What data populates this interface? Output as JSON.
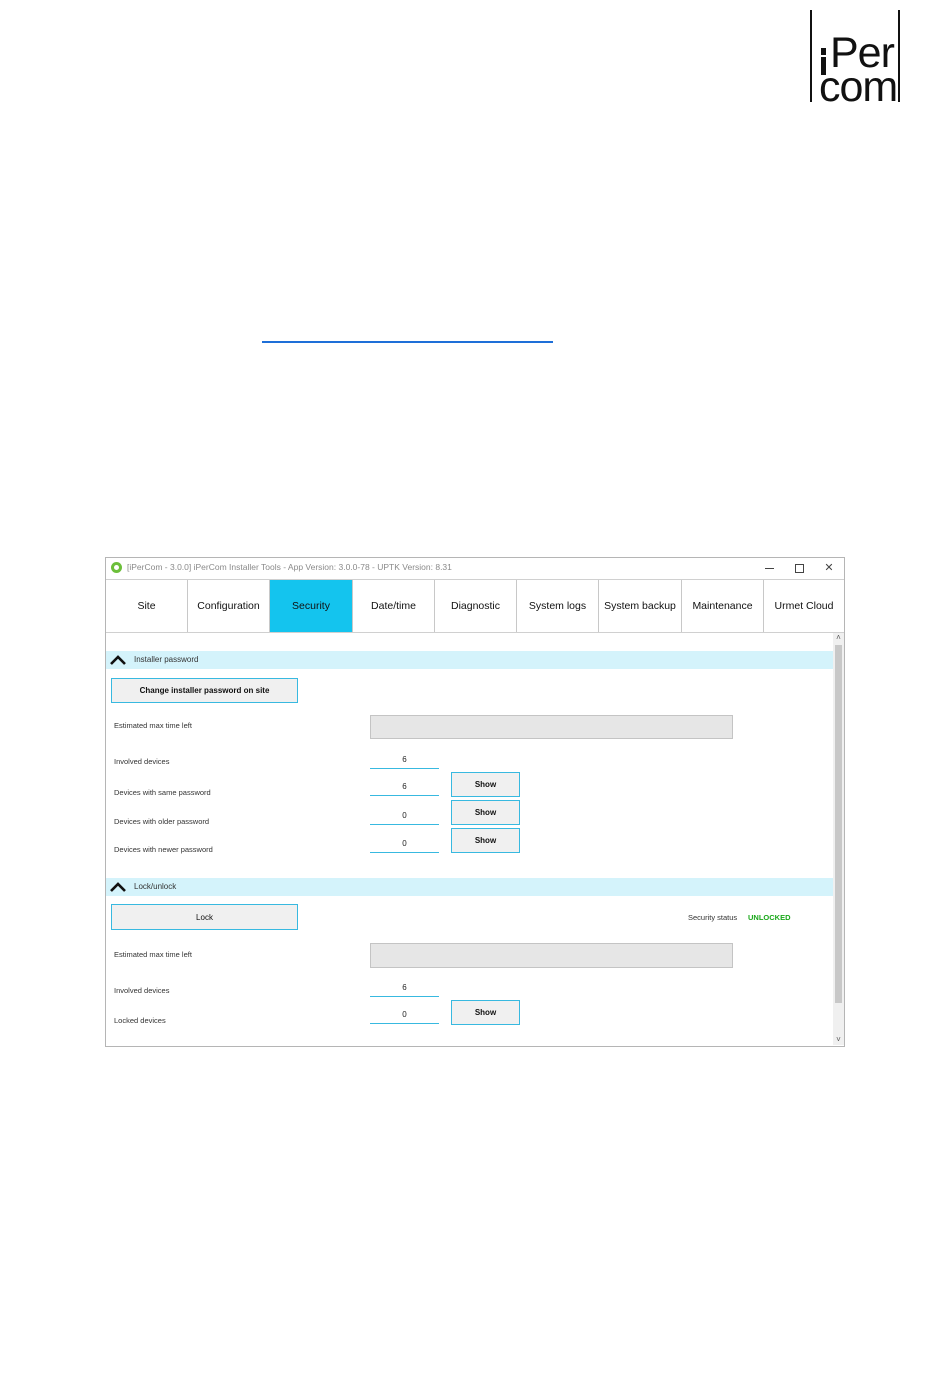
{
  "logo": {
    "line1": "Per",
    "line2": "com"
  },
  "window": {
    "title": "[iPerCom - 3.0.0] iPerCom Installer Tools - App Version: 3.0.0-78 - UPTK Version: 8.31",
    "controls": {
      "minimize_icon": "minimize-icon",
      "maximize_icon": "maximize-icon",
      "close_icon": "close-icon",
      "close": "✕"
    }
  },
  "tabs": [
    {
      "label": "Site",
      "active": false
    },
    {
      "label": "Configuration",
      "active": false
    },
    {
      "label": "Security",
      "active": true
    },
    {
      "label": "Date/time",
      "active": false
    },
    {
      "label": "Diagnostic",
      "active": false
    },
    {
      "label": "System logs",
      "active": false
    },
    {
      "label": "System backup",
      "active": false
    },
    {
      "label": "Maintenance",
      "active": false
    },
    {
      "label": "Urmet Cloud",
      "active": false
    }
  ],
  "installer_password": {
    "header": "Installer password",
    "change_button": "Change installer password on site",
    "estimated_label": "Estimated max time left",
    "involved_label": "Involved devices",
    "involved_value": "6",
    "same_label": "Devices with same password",
    "same_value": "6",
    "older_label": "Devices with older password",
    "older_value": "0",
    "newer_label": "Devices with newer password",
    "newer_value": "0",
    "show_label": "Show"
  },
  "lock_unlock": {
    "header": "Lock/unlock",
    "lock_button": "Lock",
    "security_status_label": "Security status",
    "security_status_value": "UNLOCKED",
    "estimated_label": "Estimated max time left",
    "involved_label": "Involved devices",
    "involved_value": "6",
    "locked_label": "Locked devices",
    "locked_value": "0",
    "show_label": "Show"
  },
  "scrollbar": {
    "up": "˄",
    "down": "˅"
  },
  "colors": {
    "accent": "#14c4ee",
    "section_bg": "#d4f3fb",
    "status_unlocked": "#1aa81a",
    "link": "#1e6fd8"
  }
}
